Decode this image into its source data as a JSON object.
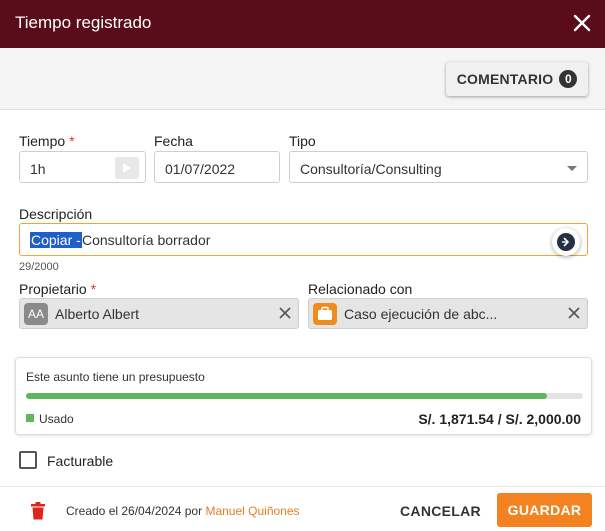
{
  "dialog": {
    "title": "Tiempo registrado"
  },
  "toolbar": {
    "comment_label": "COMENTARIO",
    "comment_count": "0"
  },
  "fields": {
    "tiempo": {
      "label": "Tiempo",
      "required_mark": "*",
      "value": "1h"
    },
    "fecha": {
      "label": "Fecha",
      "value": "01/07/2022"
    },
    "tipo": {
      "label": "Tipo",
      "value": "Consultoría/Consulting"
    },
    "descripcion": {
      "label": "Descripción",
      "selected_text": "Copiar -",
      "rest_text": "Consultoría borrador",
      "counter": "29/2000"
    },
    "propietario": {
      "label": "Propietario",
      "required_mark": "*",
      "avatar_initials": "AA",
      "value": "Alberto Albert"
    },
    "relacionado": {
      "label": "Relacionado con",
      "value": "Caso ejecución de abc..."
    }
  },
  "budget": {
    "title": "Este asunto tiene un presupuesto",
    "used_label": "Usado",
    "amounts": "S/. 1,871.54 / S/. 2,000.00",
    "used_fraction": 0.9358,
    "bar_color": "#5cb85c"
  },
  "facturable": {
    "label": "Facturable",
    "checked": false
  },
  "footer": {
    "created_prefix": "Creado el 26/04/2024 por",
    "created_by": "Manuel Quiñones",
    "cancel_label": "CANCELAR",
    "save_label": "GUARDAR"
  },
  "colors": {
    "titlebar": "#5a0c1a",
    "accent": "#f58220",
    "link": "#e67e22",
    "selection": "#1e5fc9"
  },
  "icons": [
    "close-icon",
    "play-icon",
    "chevron-down-icon",
    "ai-assistant-icon",
    "briefcase-icon",
    "clear-icon",
    "trash-icon"
  ]
}
